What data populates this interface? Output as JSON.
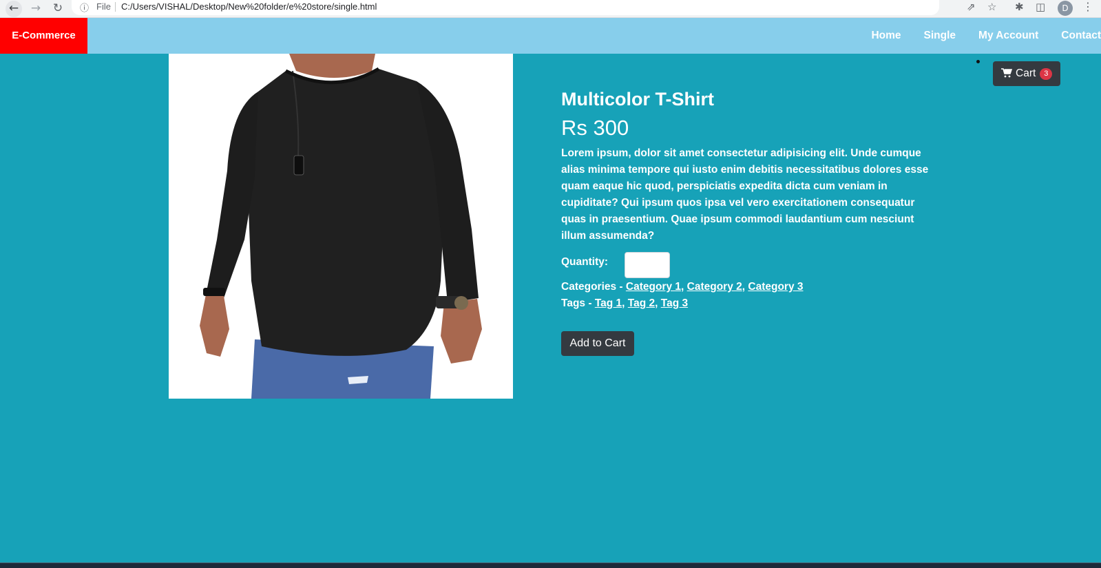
{
  "browser": {
    "file_label": "File",
    "url": "C:/Users/VISHAL/Desktop/New%20folder/e%20store/single.html",
    "profile_initial": "D"
  },
  "navbar": {
    "brand": "E-Commerce",
    "links": [
      "Home",
      "Single",
      "My Account",
      "Contact"
    ],
    "brand_color": "#ff0000",
    "bg_color": "#87ceeb"
  },
  "cart": {
    "label": "Cart",
    "count": "3",
    "icon": "shopping-cart-icon"
  },
  "product": {
    "image_desc_icon": "product-photo",
    "title": "Multicolor T-Shirt",
    "price": "Rs 300",
    "description": "Lorem ipsum, dolor sit amet consectetur adipisicing elit. Unde cumque alias minima tempore qui iusto enim debitis necessitatibus dolores esse quam eaque hic quod, perspiciatis expedita dicta cum veniam in cupiditate? Qui ipsum quos ipsa vel vero exercitationem consequatur quas in praesentium. Quae ipsum commodi laudantium cum nesciunt illum assumenda?",
    "quantity_label": "Quantity:",
    "quantity_value": "",
    "categories_label": "Categories - ",
    "categories": [
      "Category 1",
      "Category 2",
      "Category 3"
    ],
    "tags_label": "Tags - ",
    "tags": [
      "Tag 1",
      "Tag 2",
      "Tag 3"
    ],
    "add_to_cart": "Add to Cart"
  },
  "colors": {
    "page_bg": "#17a2b8",
    "button_dark": "#343a40",
    "badge_red": "#dc3545"
  }
}
